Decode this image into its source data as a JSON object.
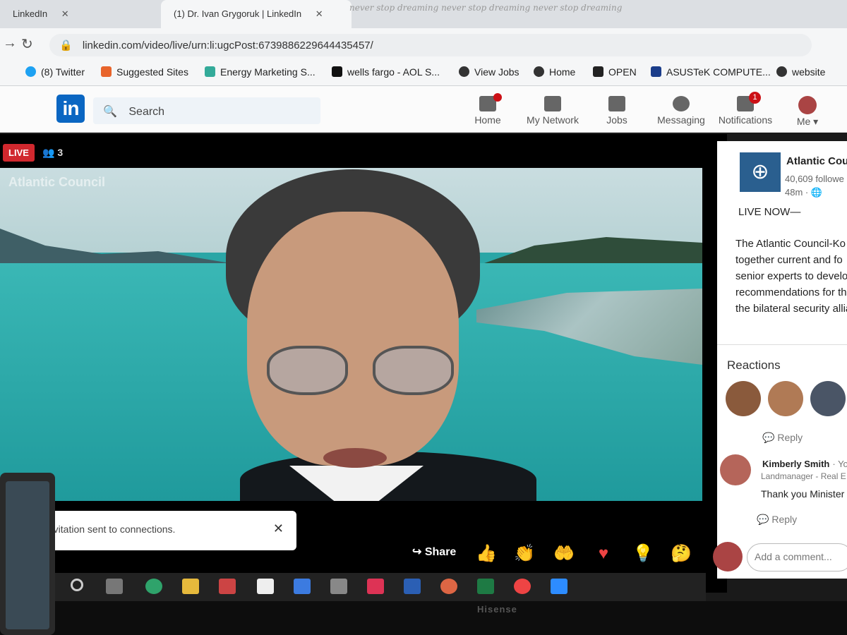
{
  "browser": {
    "tabs": [
      {
        "label": "LinkedIn"
      },
      {
        "label": "(1) Dr. Ivan Grygoruk | LinkedIn"
      }
    ],
    "promo_text": "never stop dreaming never stop dreaming never stop dreaming",
    "url": "linkedin.com/video/live/urn:li:ugcPost:6739886229644435457/",
    "bookmarks": [
      "(8) Twitter",
      "Suggested Sites",
      "Energy Marketing S...",
      "wells fargo - AOL S...",
      "View Jobs",
      "Home",
      "OPEN",
      "ASUSTeK COMPUTE...",
      "website"
    ]
  },
  "linkedin_nav": {
    "logo": "in",
    "search_placeholder": "Search",
    "items": [
      {
        "label": "Home"
      },
      {
        "label": "My Network"
      },
      {
        "label": "Jobs"
      },
      {
        "label": "Messaging"
      },
      {
        "label": "Notifications",
        "badge": "1"
      },
      {
        "label": "Me"
      }
    ]
  },
  "video": {
    "live_label": "LIVE",
    "viewer_count": "3",
    "watermark": "Atlantic Council",
    "toast": "Invitation sent to connections.",
    "share_label": "Share"
  },
  "sidebar": {
    "org_name": "Atlantic Cou",
    "followers": "40,609 followe",
    "time": "48m",
    "live_now": "LIVE NOW—",
    "desc_lines": [
      "The Atlantic Council-Ko",
      "together current and fo",
      "senior experts to develo",
      "recommendations for th",
      "the bilateral security allia"
    ],
    "reactions_heading": "Reactions",
    "reply_label": "Reply",
    "comment": {
      "author": "Kimberly Smith",
      "you": "· You",
      "subtitle": "Landmanager - Real E",
      "text": "Thank you Minister"
    },
    "compose_placeholder": "Add a comment..."
  },
  "monitor": {
    "brand": "Hisense"
  },
  "colors": {
    "linkedin_blue": "#0a66c2",
    "live_red": "#d1282e",
    "sea": "#2aa6a6"
  }
}
